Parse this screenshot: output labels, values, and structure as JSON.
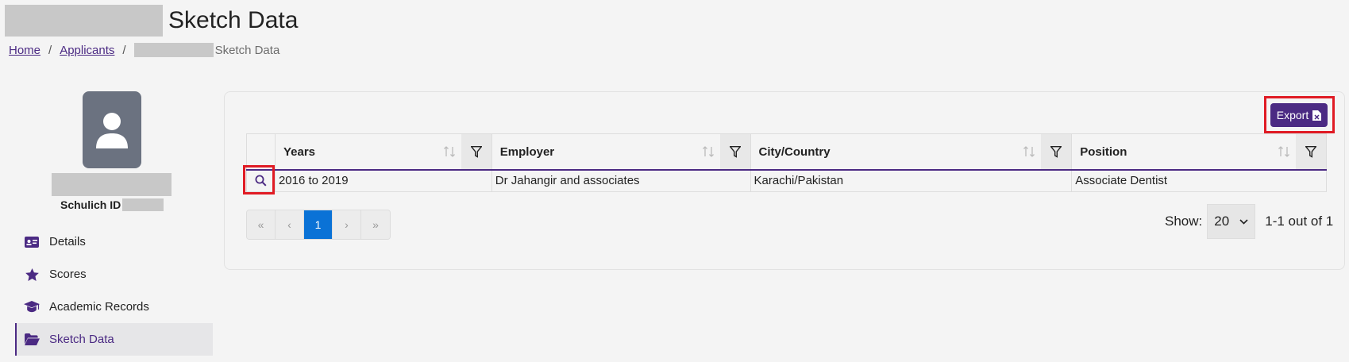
{
  "header": {
    "title": "Sketch Data"
  },
  "breadcrumb": {
    "home": "Home",
    "applicants": "Applicants",
    "current": "Sketch Data"
  },
  "profile": {
    "id_label": "Schulich ID"
  },
  "nav": {
    "items": [
      {
        "label": "Details",
        "icon": "id-card-icon"
      },
      {
        "label": "Scores",
        "icon": "star-icon"
      },
      {
        "label": "Academic Records",
        "icon": "graduation-cap-icon"
      },
      {
        "label": "Sketch Data",
        "icon": "folder-open-icon",
        "active": true
      }
    ]
  },
  "toolbar": {
    "export_label": "Export"
  },
  "table": {
    "columns": [
      "Years",
      "Employer",
      "City/Country",
      "Position"
    ],
    "rows": [
      {
        "years": "2016 to 2019",
        "employer": "Dr Jahangir and associates",
        "city": "Karachi/Pakistan",
        "position": "Associate Dentist"
      }
    ]
  },
  "pagination": {
    "first": "«",
    "prev": "‹",
    "current": "1",
    "next": "›",
    "last": "»"
  },
  "page_size": {
    "label": "Show:",
    "value": "20",
    "count": "1-1 out of 1"
  },
  "colors": {
    "accent": "#4b2a83",
    "active_page": "#0a72d6",
    "highlight": "#e01b24"
  }
}
